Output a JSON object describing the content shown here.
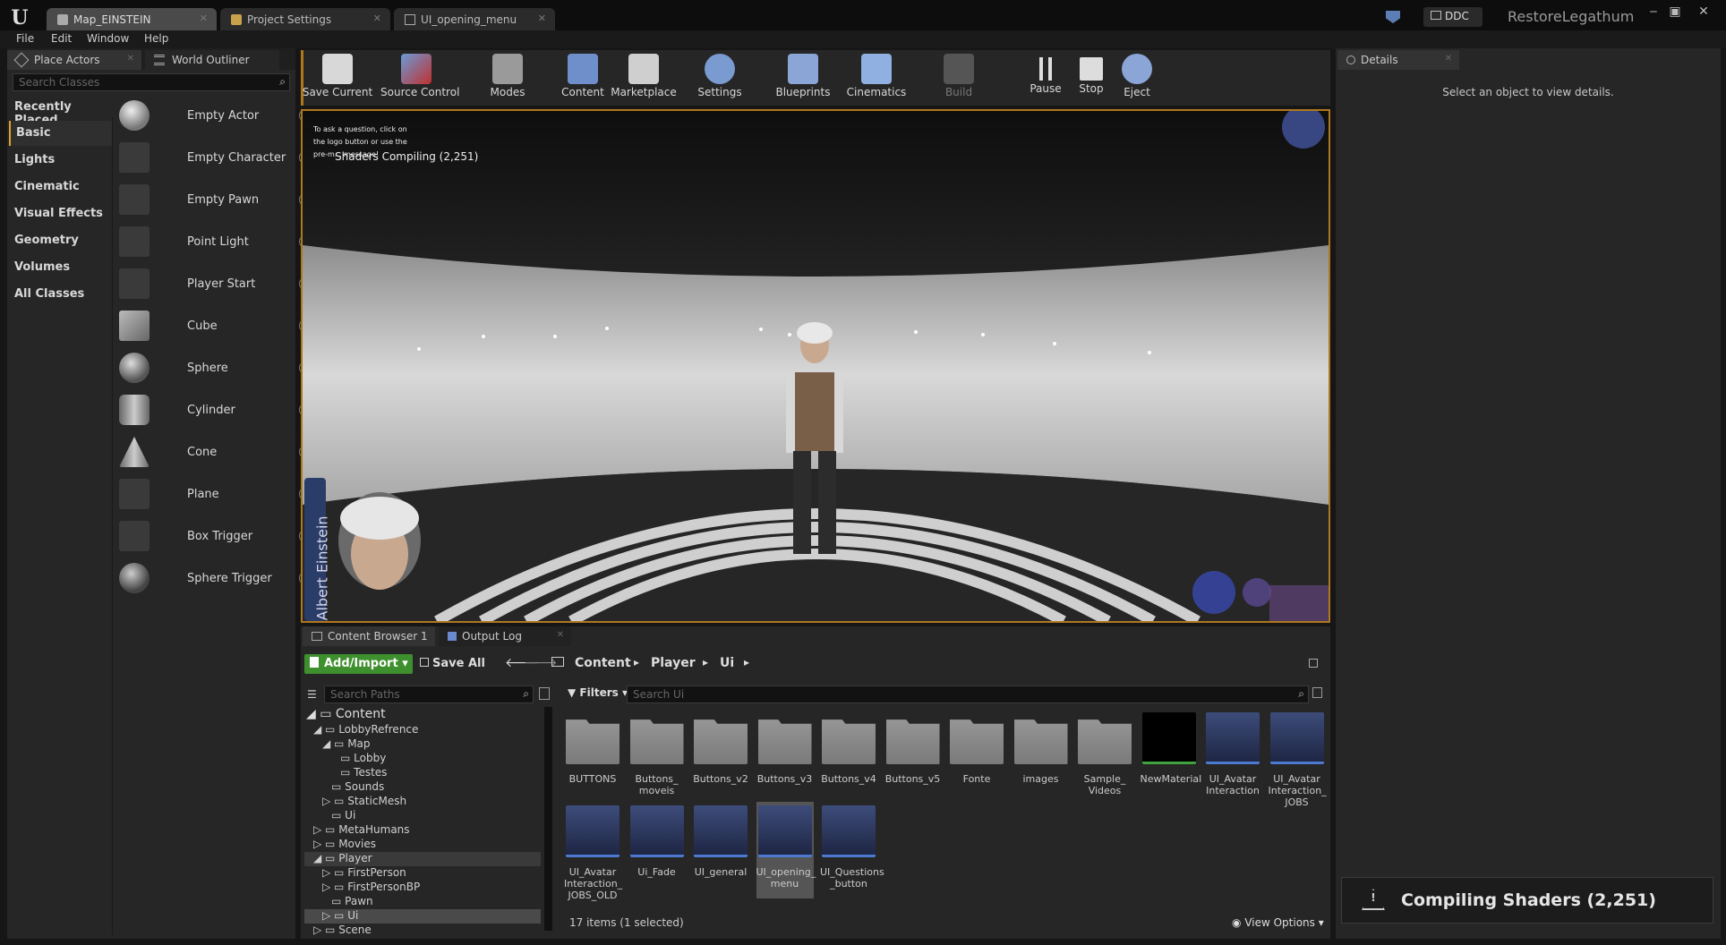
{
  "window": {
    "tabs": [
      {
        "label": "Map_EINSTEIN"
      },
      {
        "label": "Project Settings"
      },
      {
        "label": "UI_opening_menu"
      }
    ],
    "ddc_label": "DDC",
    "project_name": "RestoreLegathum"
  },
  "menu": [
    "File",
    "Edit",
    "Window",
    "Help"
  ],
  "left_panel": {
    "tabs": [
      "Place Actors",
      "World Outliner"
    ],
    "search_placeholder": "Search Classes",
    "categories": [
      "Recently Placed",
      "Basic",
      "Lights",
      "Cinematic",
      "Visual Effects",
      "Geometry",
      "Volumes",
      "All Classes"
    ],
    "selected_category": "Basic",
    "actors": [
      "Empty Actor",
      "Empty Character",
      "Empty Pawn",
      "Point Light",
      "Player Start",
      "Cube",
      "Sphere",
      "Cylinder",
      "Cone",
      "Plane",
      "Box Trigger",
      "Sphere Trigger"
    ]
  },
  "toolbar": {
    "buttons": [
      "Save Current",
      "Source Control",
      "Modes",
      "Content",
      "Marketplace",
      "Settings",
      "Blueprints",
      "Cinematics",
      "Build",
      "Pause",
      "Stop",
      "Eject"
    ]
  },
  "viewport": {
    "hint": "To ask a question, click on the logo button or use the pre-m... message!",
    "shaders_overlay": "Shaders Compiling (2,251)",
    "character_name": "Albert Einstein"
  },
  "details": {
    "tab": "Details",
    "empty_message": "Select an object to view details."
  },
  "content_browser": {
    "tabs": [
      "Content Browser 1",
      "Output Log"
    ],
    "add_import": "Add/Import",
    "save_all": "Save All",
    "breadcrumb": [
      "Content",
      "Player",
      "Ui"
    ],
    "search_paths_placeholder": "Search Paths",
    "filters_label": "Filters",
    "search_assets_placeholder": "Search Ui",
    "tree": [
      {
        "label": "Content",
        "depth": 0
      },
      {
        "label": "LobbyRefrence",
        "depth": 1
      },
      {
        "label": "Map",
        "depth": 2
      },
      {
        "label": "Lobby",
        "depth": 3
      },
      {
        "label": "Testes",
        "depth": 3
      },
      {
        "label": "Sounds",
        "depth": 2
      },
      {
        "label": "StaticMesh",
        "depth": 2
      },
      {
        "label": "Ui",
        "depth": 2
      },
      {
        "label": "MetaHumans",
        "depth": 1
      },
      {
        "label": "Movies",
        "depth": 1
      },
      {
        "label": "Player",
        "depth": 1
      },
      {
        "label": "FirstPerson",
        "depth": 2
      },
      {
        "label": "FirstPersonBP",
        "depth": 2
      },
      {
        "label": "Pawn",
        "depth": 2
      },
      {
        "label": "Ui",
        "depth": 2
      },
      {
        "label": "Scene",
        "depth": 1
      }
    ],
    "assets_row1": [
      "BUTTONS",
      "Buttons_ moveis",
      "Buttons_v2",
      "Buttons_v3",
      "Buttons_v4",
      "Buttons_v5",
      "Fonte",
      "images",
      "Sample_ Videos",
      "NewMaterial",
      "UI_Avatar Interaction",
      "UI_Avatar Interaction_ JOBS"
    ],
    "assets_row2": [
      "UI_Avatar Interaction_ JOBS_OLD",
      "Ui_Fade",
      "UI_general",
      "UI_opening_ menu",
      "UI_Questions _button"
    ],
    "status": "17 items (1 selected)",
    "view_options": "View Options"
  },
  "toast": {
    "message": "Compiling Shaders (2,251)"
  }
}
